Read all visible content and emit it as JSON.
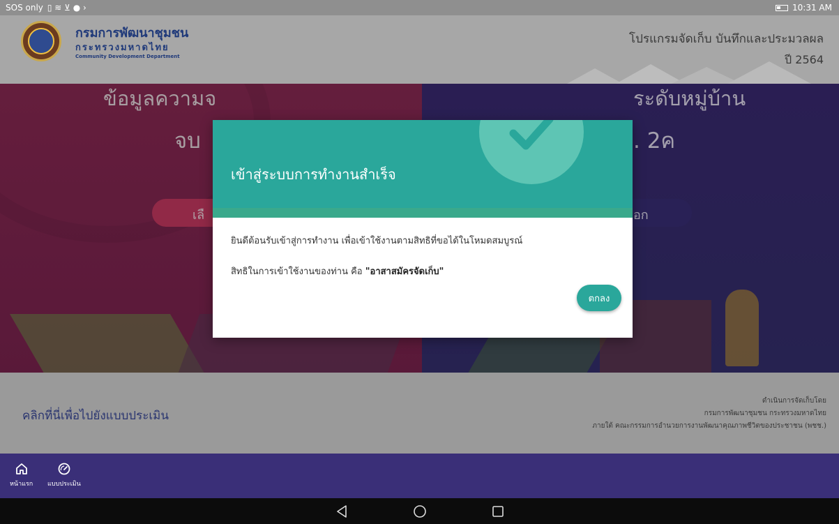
{
  "status_bar": {
    "left": "SOS only",
    "time": "10:31 AM"
  },
  "header": {
    "org_name_th": "กรมการพัฒนาชุมชน",
    "ministry_th": "กระทรวงมหาดไทย",
    "org_name_en": "Community Development Department",
    "program_title": "โปรแกรมจัดเก็บ บันทึกและประมวลผล",
    "program_year": "ปี 2564"
  },
  "hero": {
    "left_title": "ข้อมูลความจ",
    "left_sub": "จบ",
    "left_button": "เลื",
    "right_title": "ระดับหมู่บ้าน",
    "right_sub": ". 2ค",
    "right_button": "อก"
  },
  "modal": {
    "title": "เข้าสู่ระบบการทำงานสำเร็จ",
    "message_line1": "ยินดีต้อนรับเข้าสู่การทำงาน เพื่อเข้าใช้งานตามสิทธิที่ขอได้ในโหมดสมบูรณ์",
    "message_line2_prefix": "สิทธิในการเข้าใช้งานของท่าน คือ ",
    "message_line2_role": "\"อาสาสมัครจัดเก็บ\"",
    "ok_label": "ตกลง",
    "accent_color": "#2aa79b"
  },
  "footer": {
    "link_text": "คลิกที่นี่เพื่อไปยังแบบประเมิน",
    "credit_line1": "ดำเนินการจัดเก็บโดย",
    "credit_line2": "กรมการพัฒนาชุมชน กระทรวงมหาดไทย",
    "credit_line3": "ภายใต้ คณะกรรมการอำนวยการงานพัฒนาคุณภาพชีวิตของประชาชน (พชช.)"
  },
  "bottom_nav": {
    "items": [
      {
        "label": "หน้าแรก",
        "icon": "home-icon"
      },
      {
        "label": "แบบประเมิน",
        "icon": "gauge-icon"
      }
    ]
  },
  "android_nav": [
    "back-icon",
    "home-circle-icon",
    "recents-icon"
  ]
}
